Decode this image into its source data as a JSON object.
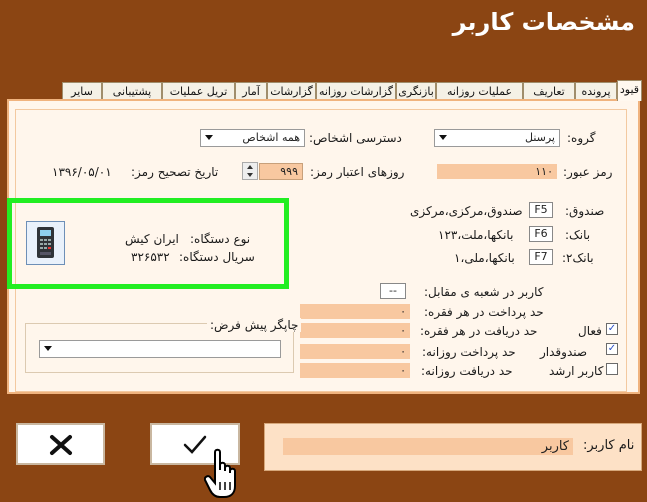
{
  "window": {
    "title": "مشخصات کاربر"
  },
  "tabs": [
    {
      "label": "قیود",
      "active": true
    },
    {
      "label": "پرونده"
    },
    {
      "label": "تعاریف"
    },
    {
      "label": "عملیات روزانه"
    },
    {
      "label": "بازنگری"
    },
    {
      "label": "گزارشات روزانه"
    },
    {
      "label": "گزارشات"
    },
    {
      "label": "آمار"
    },
    {
      "label": "تریل عملیات"
    },
    {
      "label": "پشتیبانی"
    },
    {
      "label": "سایر"
    }
  ],
  "form": {
    "group_label": "گروه:",
    "group_value": "پرسنل",
    "access_label": "دسترسی اشخاص:",
    "access_value": "همه اشخاص",
    "password_label": "رمز عبور:",
    "password_value": "۱۱۰",
    "validity_label": "روزهای اعتبار رمز:",
    "validity_value": "۹۹۹",
    "pwdate_label": "تاریخ تصحیح رمز:",
    "pwdate_value": "۱۳۹۶/۰۵/۰۱",
    "cashbox_label": "صندوق:",
    "cashbox_code": "F5",
    "cashbox_value": "صندوق،مرکزی،مرکزی",
    "bank_label": "بانک:",
    "bank_code": "F6",
    "bank_value": "بانکها،ملت،۱۲۳",
    "bank2_label": "بانک۲:",
    "bank2_code": "F7",
    "bank2_value": "بانکها،ملی،۱",
    "device_type_label": "نوع دستگاه:",
    "device_type_value": "ایران کیش",
    "device_serial_label": "سریال دستگاه:",
    "device_serial_value": "۳۲۶۵۳۲",
    "branch_user_label": "کاربر در شعبه ی مقابل:",
    "branch_user_value": "--",
    "pay_per_item_label": "حد پرداخت در هر فقره:",
    "pay_per_item_value": "۰",
    "recv_per_item_label": "حد دریافت در هر فقره:",
    "recv_per_item_value": "۰",
    "pay_daily_label": "حد پرداخت روزانه:",
    "pay_daily_value": "۰",
    "recv_daily_label": "حد دریافت روزانه:",
    "recv_daily_value": "۰",
    "active_label": "فعال",
    "active_checked": "✓",
    "cashier_label": "صندوقدار",
    "cashier_checked": "✓",
    "senior_label": "کاربر ارشد",
    "senior_checked": "",
    "printer_label": "چاپگر پیش فرض:",
    "printer_value": ""
  },
  "footer": {
    "cancel_symbol": "✕",
    "ok_symbol": "✓",
    "username_label": "نام کاربر:",
    "username_value": "کاربر"
  },
  "colors": {
    "background": "#8b4513",
    "panel": "#fff6ec",
    "field": "#f8c8a0",
    "highlight": "#22ee22"
  }
}
